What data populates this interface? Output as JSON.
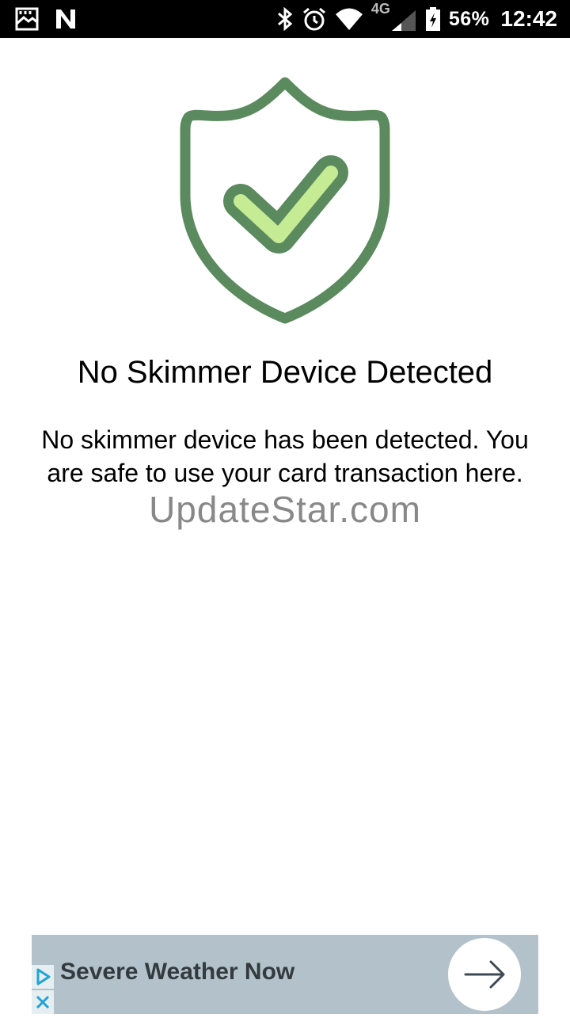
{
  "status_bar": {
    "icons_left": [
      "gallery-notification-icon",
      "n-notification-icon"
    ],
    "icons_right": [
      "bluetooth-icon",
      "alarm-icon",
      "wifi-icon",
      "cellular-signal-icon",
      "battery-icon"
    ],
    "network_label": "4G",
    "battery_percent": "56%",
    "time": "12:42"
  },
  "shield": {
    "outline_color": "#5b8a5e",
    "check_fill_color": "#c5eb94"
  },
  "result": {
    "title": "No Skimmer Device Detected",
    "message": "No skimmer device has been detected. You are safe to use your card transaction here."
  },
  "watermark": "UpdateStar.com",
  "ad": {
    "title": "Severe Weather Now",
    "background_color": "#b3c2ca",
    "adchoices_icon": "play-triangle-icon",
    "close_icon": "close-icon",
    "arrow_icon": "arrow-right-icon"
  }
}
